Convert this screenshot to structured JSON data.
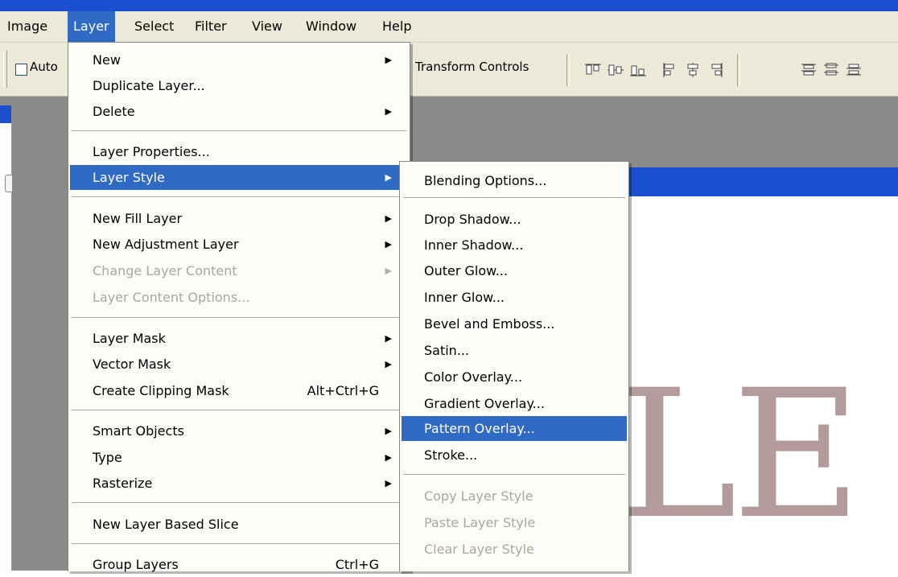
{
  "menubar": [
    {
      "label": "Image",
      "active": false
    },
    {
      "label": "Layer",
      "active": true
    },
    {
      "label": "Select",
      "active": false
    },
    {
      "label": "Filter",
      "active": false
    },
    {
      "label": "View",
      "active": false
    },
    {
      "label": "Window",
      "active": false
    },
    {
      "label": "Help",
      "active": false
    }
  ],
  "options_bar": {
    "auto_label": "Auto",
    "transform_controls_label": "Transform Controls"
  },
  "layer_menu": {
    "items": [
      {
        "label": "New",
        "submenu": true,
        "state": "normal"
      },
      {
        "label": "Duplicate Layer...",
        "state": "normal"
      },
      {
        "label": "Delete",
        "submenu": true,
        "state": "normal"
      },
      {
        "label": "Layer Properties...",
        "state": "normal"
      },
      {
        "label": "Layer Style",
        "submenu": true,
        "state": "highlighted"
      },
      {
        "label": "New Fill Layer",
        "submenu": true,
        "state": "normal"
      },
      {
        "label": "New Adjustment Layer",
        "submenu": true,
        "state": "normal"
      },
      {
        "label": "Change Layer Content",
        "submenu": true,
        "state": "disabled"
      },
      {
        "label": "Layer Content Options...",
        "state": "disabled"
      },
      {
        "label": "Layer Mask",
        "submenu": true,
        "state": "normal"
      },
      {
        "label": "Vector Mask",
        "submenu": true,
        "state": "normal"
      },
      {
        "label": "Create Clipping Mask",
        "shortcut": "Alt+Ctrl+G",
        "state": "normal"
      },
      {
        "label": "Smart Objects",
        "submenu": true,
        "state": "normal"
      },
      {
        "label": "Type",
        "submenu": true,
        "state": "normal"
      },
      {
        "label": "Rasterize",
        "submenu": true,
        "state": "normal"
      },
      {
        "label": "New Layer Based Slice",
        "state": "normal"
      },
      {
        "label": "Group Layers",
        "shortcut": "Ctrl+G",
        "state": "normal"
      }
    ]
  },
  "layer_style_menu": {
    "items": [
      {
        "label": "Blending Options...",
        "state": "normal"
      },
      {
        "label": "Drop Shadow...",
        "state": "normal"
      },
      {
        "label": "Inner Shadow...",
        "state": "normal"
      },
      {
        "label": "Outer Glow...",
        "state": "normal"
      },
      {
        "label": "Inner Glow...",
        "state": "normal"
      },
      {
        "label": "Bevel and Emboss...",
        "state": "normal"
      },
      {
        "label": "Satin...",
        "state": "normal"
      },
      {
        "label": "Color Overlay...",
        "state": "normal"
      },
      {
        "label": "Gradient Overlay...",
        "state": "normal"
      },
      {
        "label": "Pattern Overlay...",
        "state": "highlighted"
      },
      {
        "label": "Stroke...",
        "state": "normal"
      },
      {
        "label": "Copy Layer Style",
        "state": "disabled"
      },
      {
        "label": "Paste Layer Style",
        "state": "disabled"
      },
      {
        "label": "Clear Layer Style",
        "state": "disabled"
      }
    ]
  },
  "canvas": {
    "visible_text": "LE"
  },
  "colors": {
    "highlight": "#316ac5",
    "title_bar": "#1a4fd0",
    "workspace": "#8b8b8b",
    "canvas_text": "#b39b9b"
  }
}
